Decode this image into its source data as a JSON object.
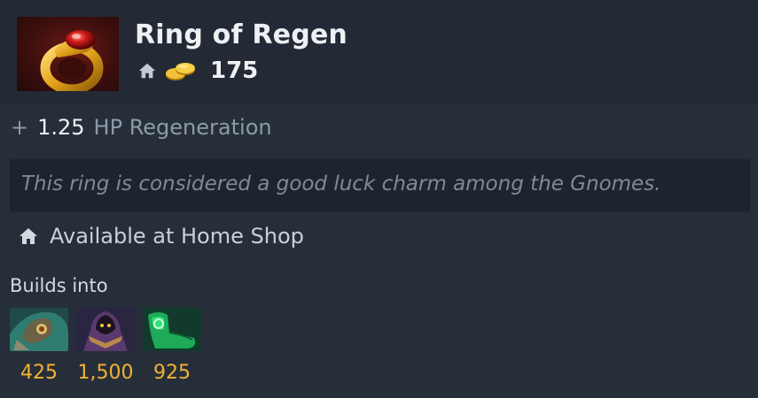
{
  "item": {
    "title": "Ring of Regen",
    "cost": "175",
    "image_icon": "ring-of-regen-icon"
  },
  "stat": {
    "plus": "+",
    "value": "1.25",
    "name": "HP Regeneration"
  },
  "lore": "This ring is considered a good luck charm among the Gnomes.",
  "availability": "Available at Home Shop",
  "builds": {
    "label": "Builds into",
    "items": [
      {
        "icon": "headdress-icon",
        "cost": "425"
      },
      {
        "icon": "cloak-icon",
        "cost": "1,500"
      },
      {
        "icon": "boots-icon",
        "cost": "925"
      }
    ]
  },
  "colors": {
    "background": "#262e3a",
    "header": "#232a36",
    "lore_box": "#1d242e",
    "gold": "#f2b233",
    "stat_name": "#8d9aa8"
  }
}
